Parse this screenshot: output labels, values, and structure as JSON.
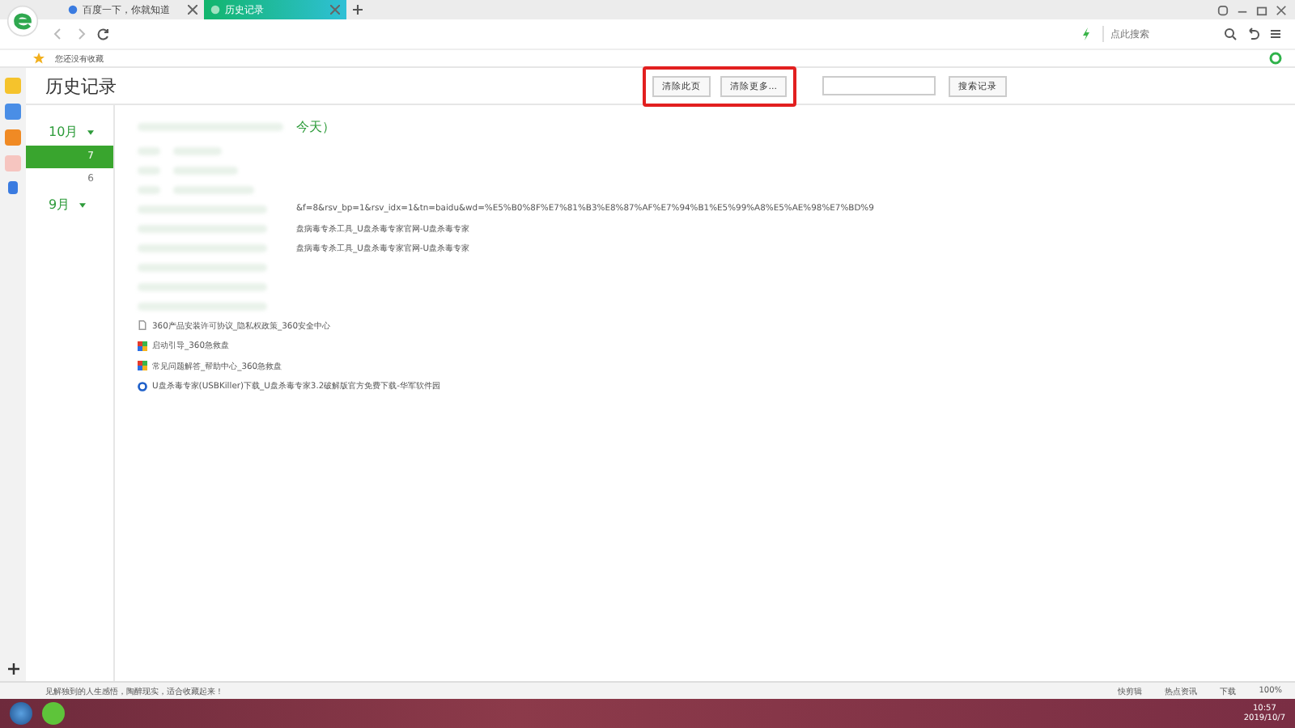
{
  "tabs": [
    {
      "title": "百度一下，你就知道",
      "selected": false
    },
    {
      "title": "历史记录",
      "selected": true
    }
  ],
  "address_bar": {
    "placeholder": "点此搜索"
  },
  "bookmarks_bar": {
    "text": "您还没有收藏"
  },
  "page": {
    "title": "历史记录",
    "highlight_frame": true,
    "buttons": [
      {
        "label": "清除此页"
      },
      {
        "label": "清除更多..."
      }
    ],
    "search_button": "搜索记录",
    "months": [
      {
        "label": "10月",
        "days": [
          {
            "label": "7",
            "selected": true
          },
          {
            "label": "6",
            "selected": false
          }
        ]
      },
      {
        "label": "9月"
      }
    ],
    "day_heading": "今天）",
    "partial_rows": [
      "&f=8&rsv_bp=1&rsv_idx=1&tn=baidu&wd=%E5%B0%8F%E7%81%B3%E8%87%AF%E7%94%B1%E5%99%A8%E5%AE%98%E7%BD%9",
      "盘病毒专杀工具_U盘杀毒专家官网-U盘杀毒专家",
      "盘病毒专杀工具_U盘杀毒专家官网-U盘杀毒专家"
    ],
    "rows": [
      {
        "kind": "page",
        "title": "360产品安装许可协议_隐私权政策_360安全中心"
      },
      {
        "kind": "tiles",
        "title": "启动引导_360急救盘"
      },
      {
        "kind": "tiles",
        "title": "常见问题解答_帮助中心_360急救盘"
      },
      {
        "kind": "ring",
        "title": "U盘杀毒专家(USBKiller)下载_U盘杀毒专家3.2破解版官方免费下载-华军软件园"
      }
    ]
  },
  "status_bar": {
    "message": "见解独到的人生感悟，陶醉现实，适合收藏起来！",
    "items": [
      "快剪辑",
      "热点资讯",
      "下载"
    ],
    "zoom": "100%"
  },
  "taskbar": {
    "time": "10:57",
    "date": "2019/10/7"
  }
}
